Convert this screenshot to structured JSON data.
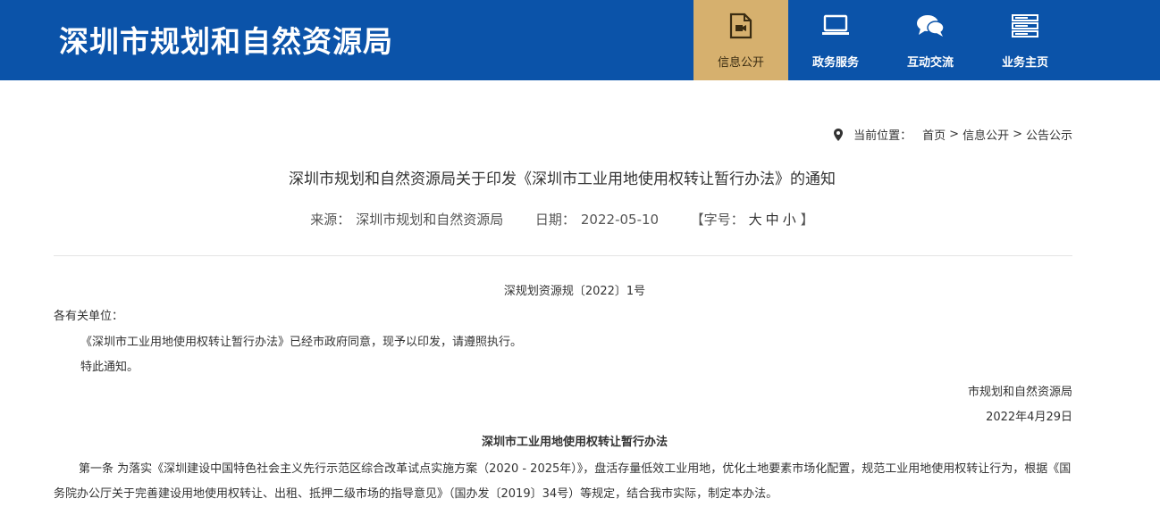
{
  "header": {
    "site_title": "深圳市规划和自然资源局",
    "nav": [
      {
        "label": "信息公开",
        "icon": "document-video-icon",
        "active": true
      },
      {
        "label": "政务服务",
        "icon": "monitor-icon",
        "active": false
      },
      {
        "label": "互动交流",
        "icon": "chat-bubbles-icon",
        "active": false
      },
      {
        "label": "业务主页",
        "icon": "server-list-icon",
        "active": false
      }
    ]
  },
  "breadcrumb": {
    "label": "当前位置：",
    "items": [
      "首页",
      "信息公开",
      "公告公示"
    ],
    "separator": ">"
  },
  "article": {
    "title": "深圳市规划和自然资源局关于印发《深圳市工业用地使用权转让暂行办法》的通知",
    "source_label": "来源：",
    "source": "深圳市规划和自然资源局",
    "date_label": "日期：",
    "date": "2022-05-10",
    "font_size_label": "【字号：",
    "font_large": "大",
    "font_medium": "中",
    "font_small": "小",
    "font_size_close": "】",
    "doc_number": "深规划资源规〔2022〕1号",
    "salutation": "各有关单位：",
    "paragraph_1": "《深圳市工业用地使用权转让暂行办法》已经市政府同意，现予以印发，请遵照执行。",
    "paragraph_2": "特此通知。",
    "sign_org": "市规划和自然资源局",
    "sign_date": "2022年4月29日",
    "law_title": "深圳市工业用地使用权转让暂行办法",
    "article_1": "第一条 为落实《深圳建设中国特色社会主义先行示范区综合改革试点实施方案（2020 - 2025年）》，盘活存量低效工业用地，优化土地要素市场化配置，规范工业用地使用权转让行为，根据《国务院办公厅关于完善建设用地使用权转让、出租、抵押二级市场的指导意见》（国办发〔2019〕34号）等规定，结合我市实际，制定本办法。"
  },
  "colors": {
    "header_bg": "#0b53a9",
    "active_nav_bg": "#d6b06e"
  }
}
